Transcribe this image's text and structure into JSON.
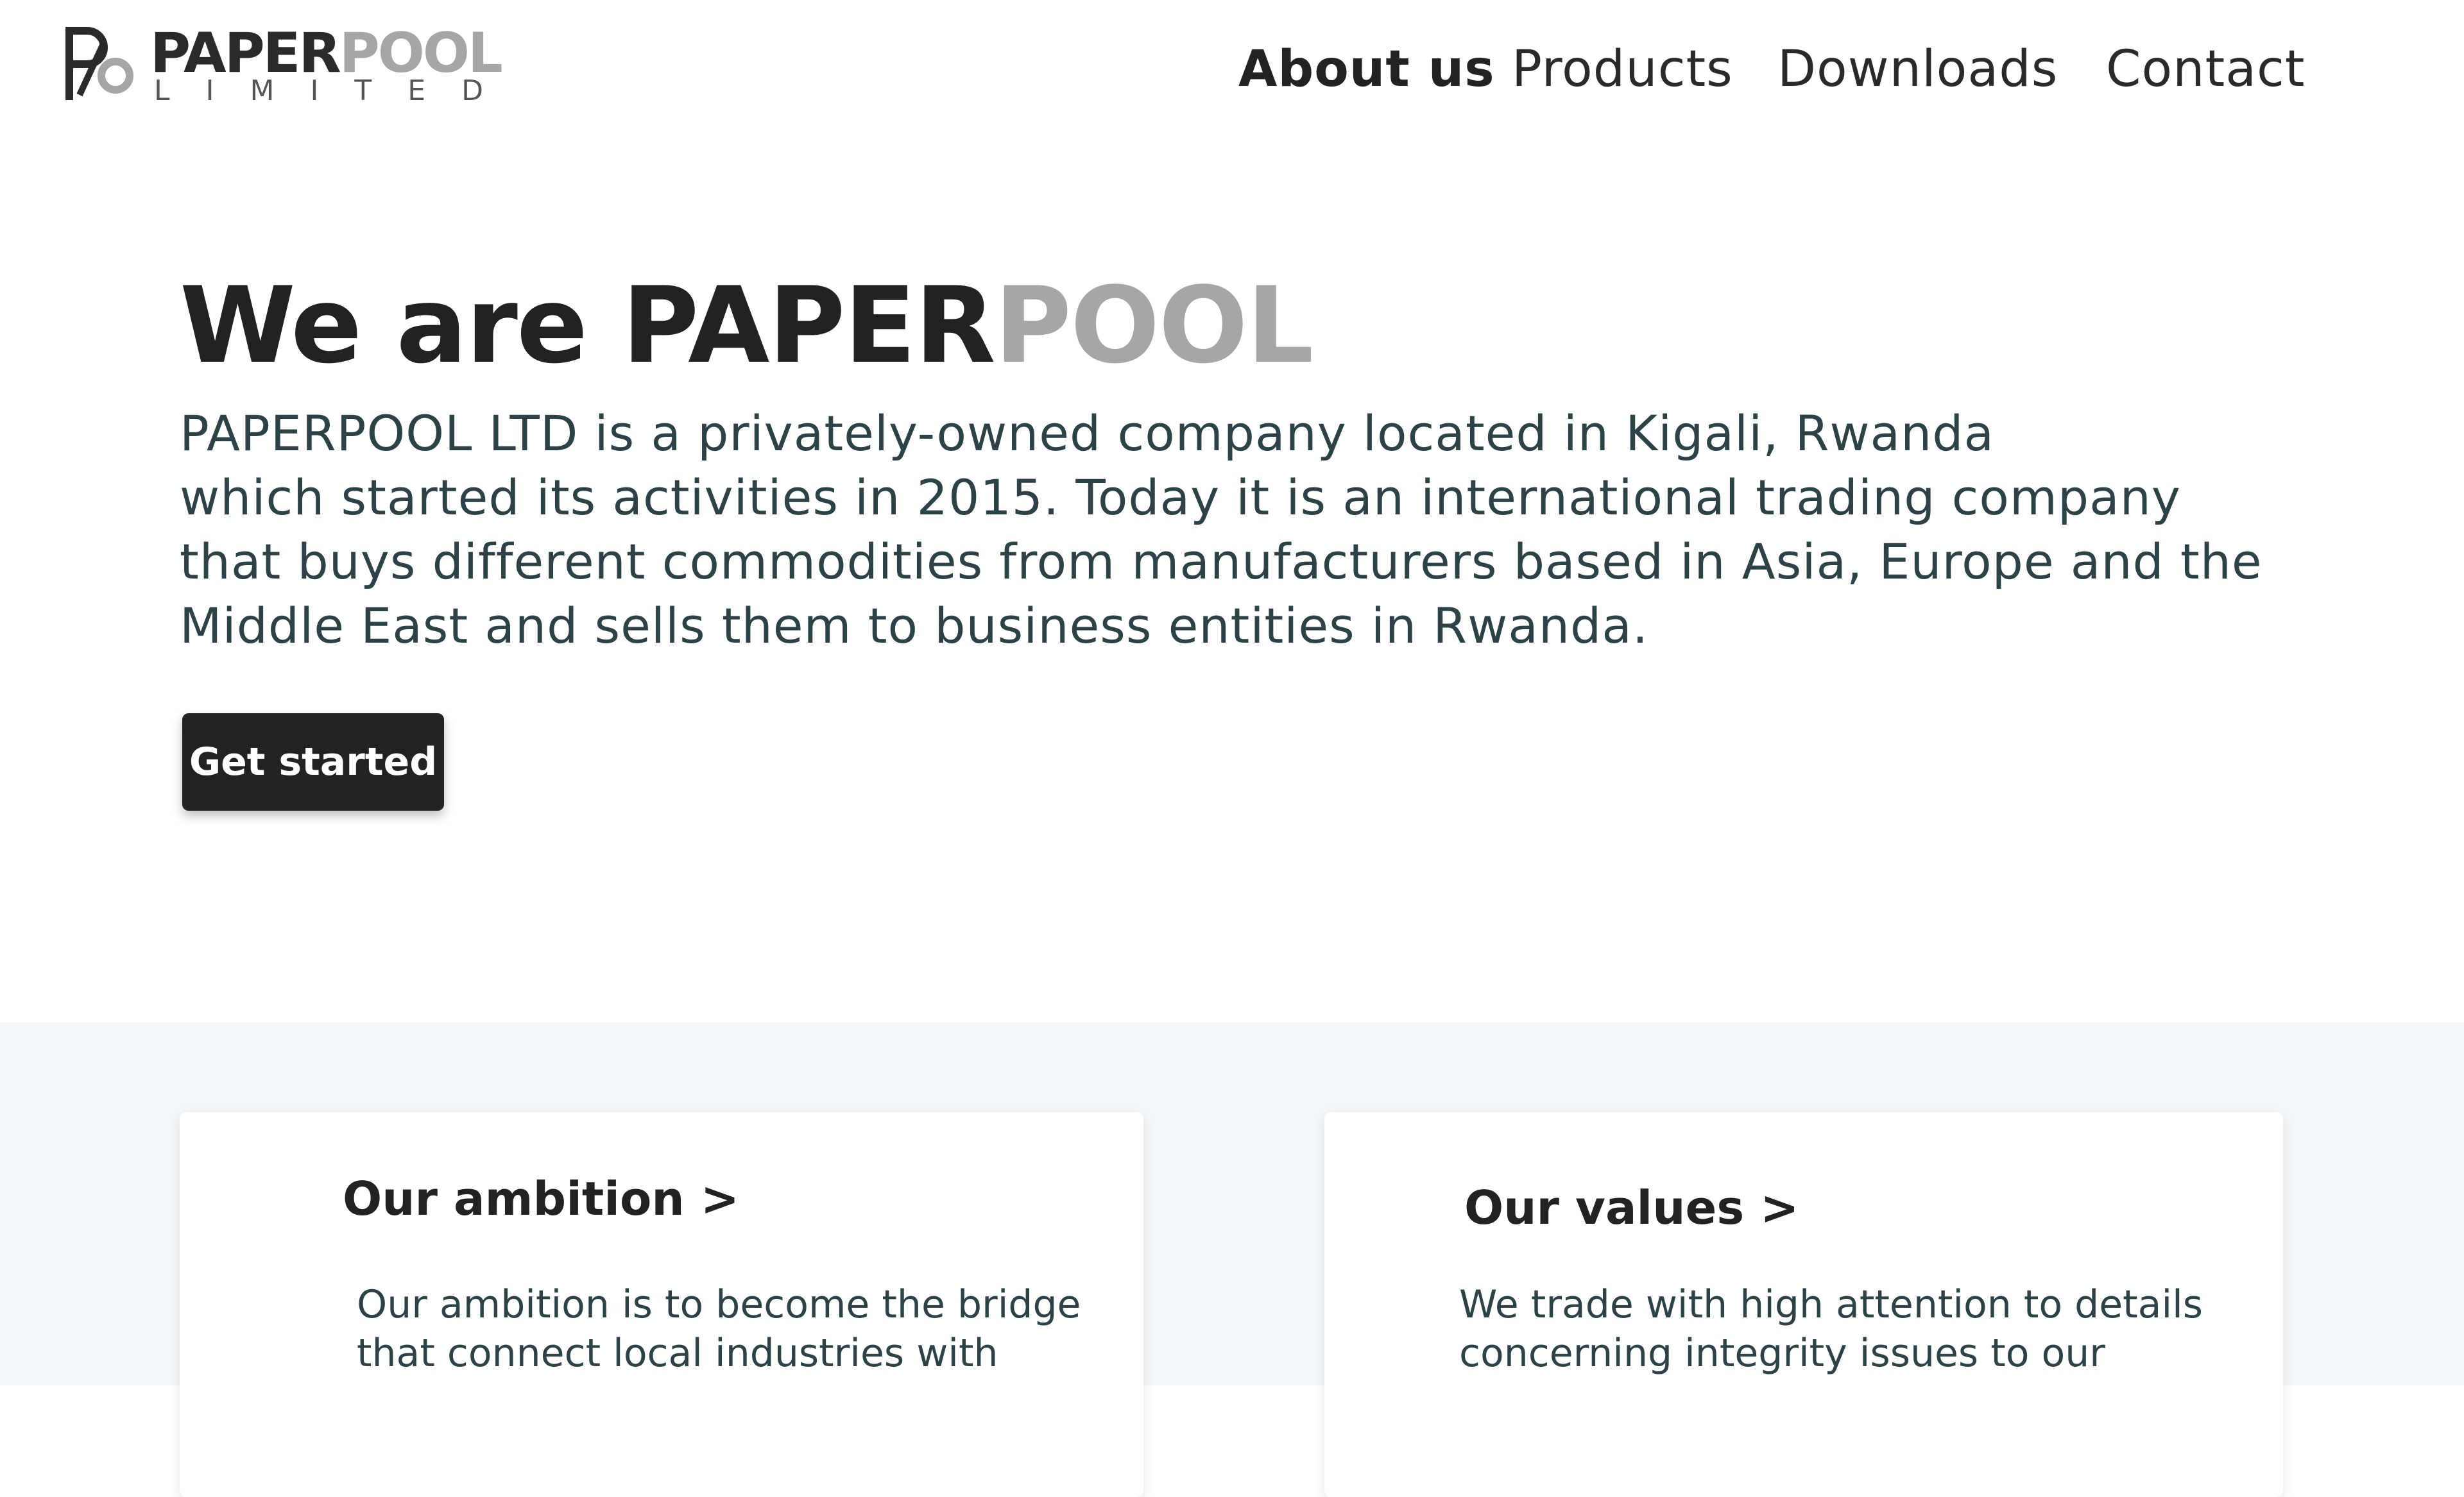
{
  "header": {
    "logo": {
      "word_dark": "PAPER",
      "word_grey": "POOL",
      "subline": "LIMITED"
    },
    "nav": [
      {
        "label": "About us",
        "active": true
      },
      {
        "label": "Products",
        "active": false
      },
      {
        "label": "Downloads",
        "active": false
      },
      {
        "label": "Contact",
        "active": false
      }
    ]
  },
  "hero": {
    "title_dark": "We are PAPER",
    "title_grey": "POOL",
    "description_lines": [
      "PAPERPOOL LTD is a privately-owned company located in Kigali, Rwanda",
      "which started its activities in 2015. Today it is an international trading company",
      "that buys different commodities from manufacturers based in Asia, Europe and the",
      "Middle East and sells them to business entities in Rwanda."
    ],
    "cta_label": "Get started"
  },
  "cards": [
    {
      "title": "Our ambition >",
      "text_lines": [
        "Our ambition is to become the bridge",
        "that connect local industries with"
      ]
    },
    {
      "title": "Our values >",
      "text_lines": [
        "We trade with high attention to details",
        "concerning integrity issues to our"
      ]
    }
  ],
  "colors": {
    "primary_dark": "#222222",
    "accent_grey": "#a6a6a6",
    "body_text": "#2c4247",
    "section_bg": "#f4f7fa"
  }
}
